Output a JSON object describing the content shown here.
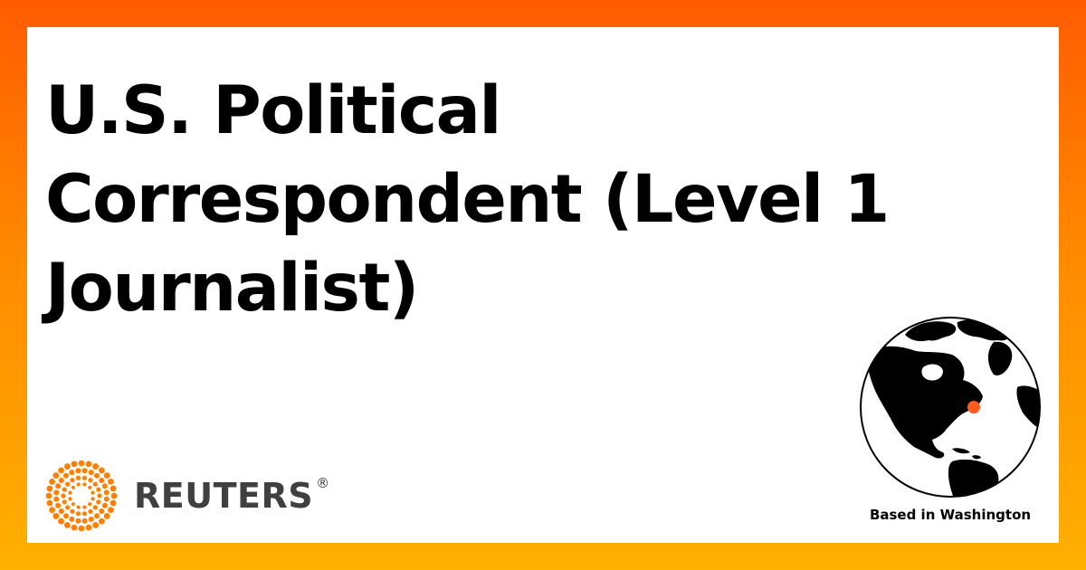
{
  "title": "U.S. Political Correspondent (Level 1 Journalist)",
  "brand": {
    "name": "REUTERS",
    "registered_mark": "®",
    "logo_icon": "reuters-dot-ring-logo",
    "accent_color": "#ff8000"
  },
  "location": {
    "label": "Based in Washington",
    "icon": "globe-icon",
    "marker_color": "#ff5a1f"
  },
  "colors": {
    "background_gradient_top": "#ff5c00",
    "background_gradient_bottom": "#ffb000",
    "card": "#ffffff",
    "title_text": "#000000",
    "wordmark_text": "#404040"
  }
}
